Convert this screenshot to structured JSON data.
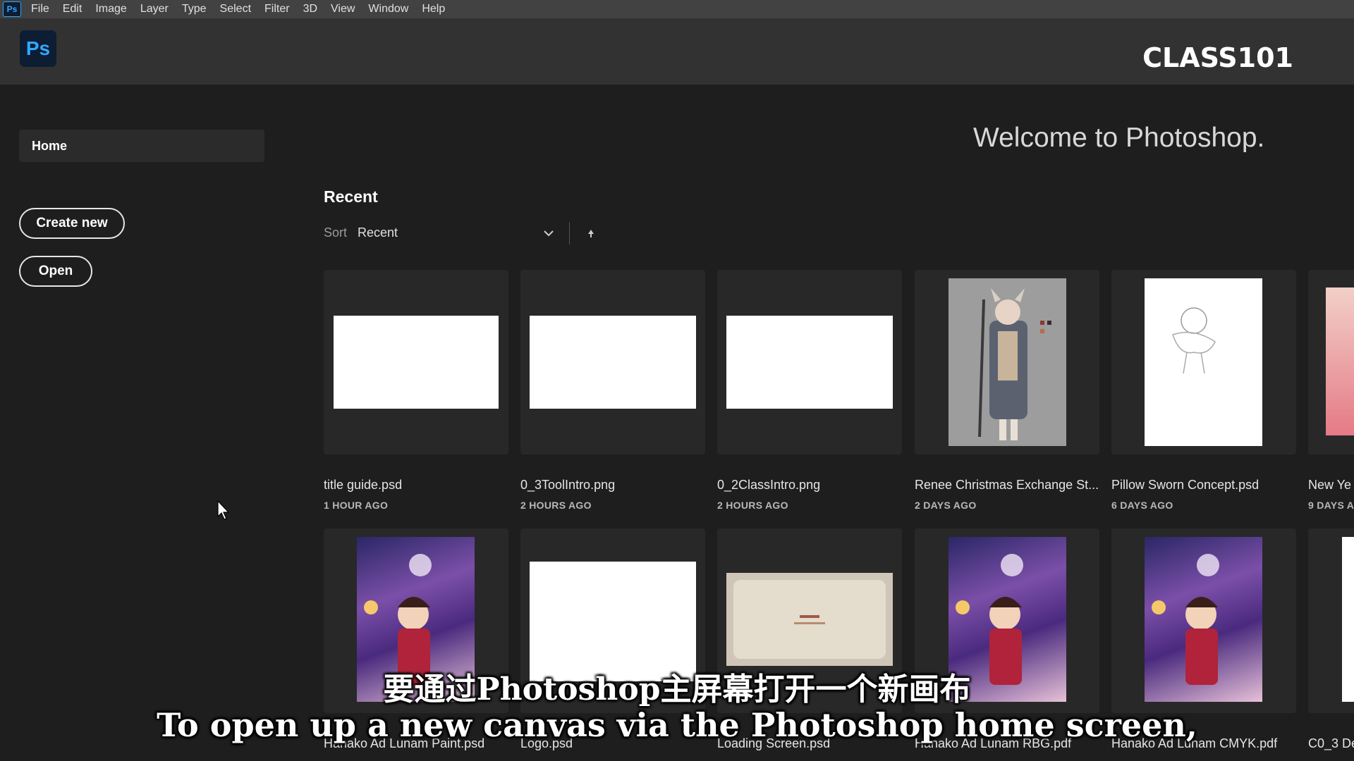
{
  "menubar": {
    "app_icon": "Ps",
    "items": [
      "File",
      "Edit",
      "Image",
      "Layer",
      "Type",
      "Select",
      "Filter",
      "3D",
      "View",
      "Window",
      "Help"
    ]
  },
  "header": {
    "logo": "Ps",
    "brand": "CLASS101"
  },
  "sidebar": {
    "home": "Home",
    "create_new": "Create new",
    "open": "Open"
  },
  "main": {
    "welcome": "Welcome to Photoshop.",
    "recent_title": "Recent",
    "sort_label": "Sort",
    "sort_value": "Recent"
  },
  "files": [
    {
      "name": "title guide.psd",
      "time": "1 HOUR AGO"
    },
    {
      "name": "0_3ToolIntro.png",
      "time": "2 HOURS AGO"
    },
    {
      "name": "0_2ClassIntro.png",
      "time": "2 HOURS AGO"
    },
    {
      "name": "Renee Christmas Exchange St...",
      "time": "2 DAYS AGO"
    },
    {
      "name": "Pillow Sworn Concept.psd",
      "time": "6 DAYS AGO"
    },
    {
      "name": "New Ye",
      "time": "9 DAYS AG"
    },
    {
      "name": "Hanako Ad Lunam Paint.psd",
      "time": ""
    },
    {
      "name": "Logo.psd",
      "time": ""
    },
    {
      "name": "Loading Screen.psd",
      "time": ""
    },
    {
      "name": "Hanako Ad Lunam RBG.pdf",
      "time": ""
    },
    {
      "name": "Hanako Ad Lunam CMYK.pdf",
      "time": ""
    },
    {
      "name": "C0_3 De",
      "time": ""
    }
  ],
  "subtitles": {
    "chinese": "要通过Photoshop主屏幕打开一个新画布",
    "english": "To open up a new canvas via the Photoshop home screen,"
  }
}
